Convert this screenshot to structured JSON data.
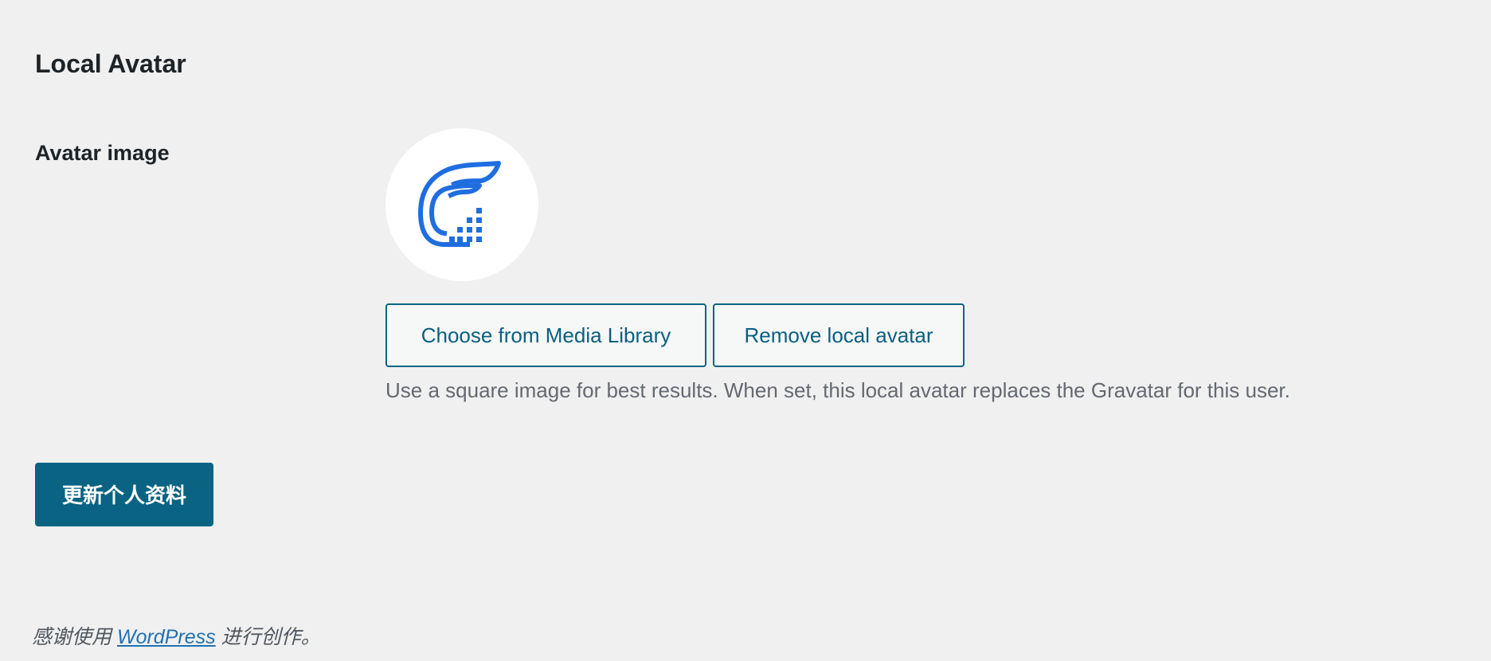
{
  "section": {
    "title": "Local Avatar"
  },
  "avatar_field": {
    "label": "Avatar image",
    "image_icon": "blue-c-logo-icon",
    "choose_button_label": "Choose from Media Library",
    "remove_button_label": "Remove local avatar",
    "description": "Use a square image for best results. When set, this local avatar replaces the Gravatar for this user."
  },
  "submit": {
    "label": "更新个人资料"
  },
  "footer": {
    "prefix": "感谢使用",
    "link_text": "WordPress",
    "suffix": "进行创作。"
  },
  "colors": {
    "background": "#f0f0f1",
    "primary": "#0a6383",
    "logo_blue": "#1f6ee0",
    "muted_text": "#646970",
    "link": "#2271b1"
  }
}
